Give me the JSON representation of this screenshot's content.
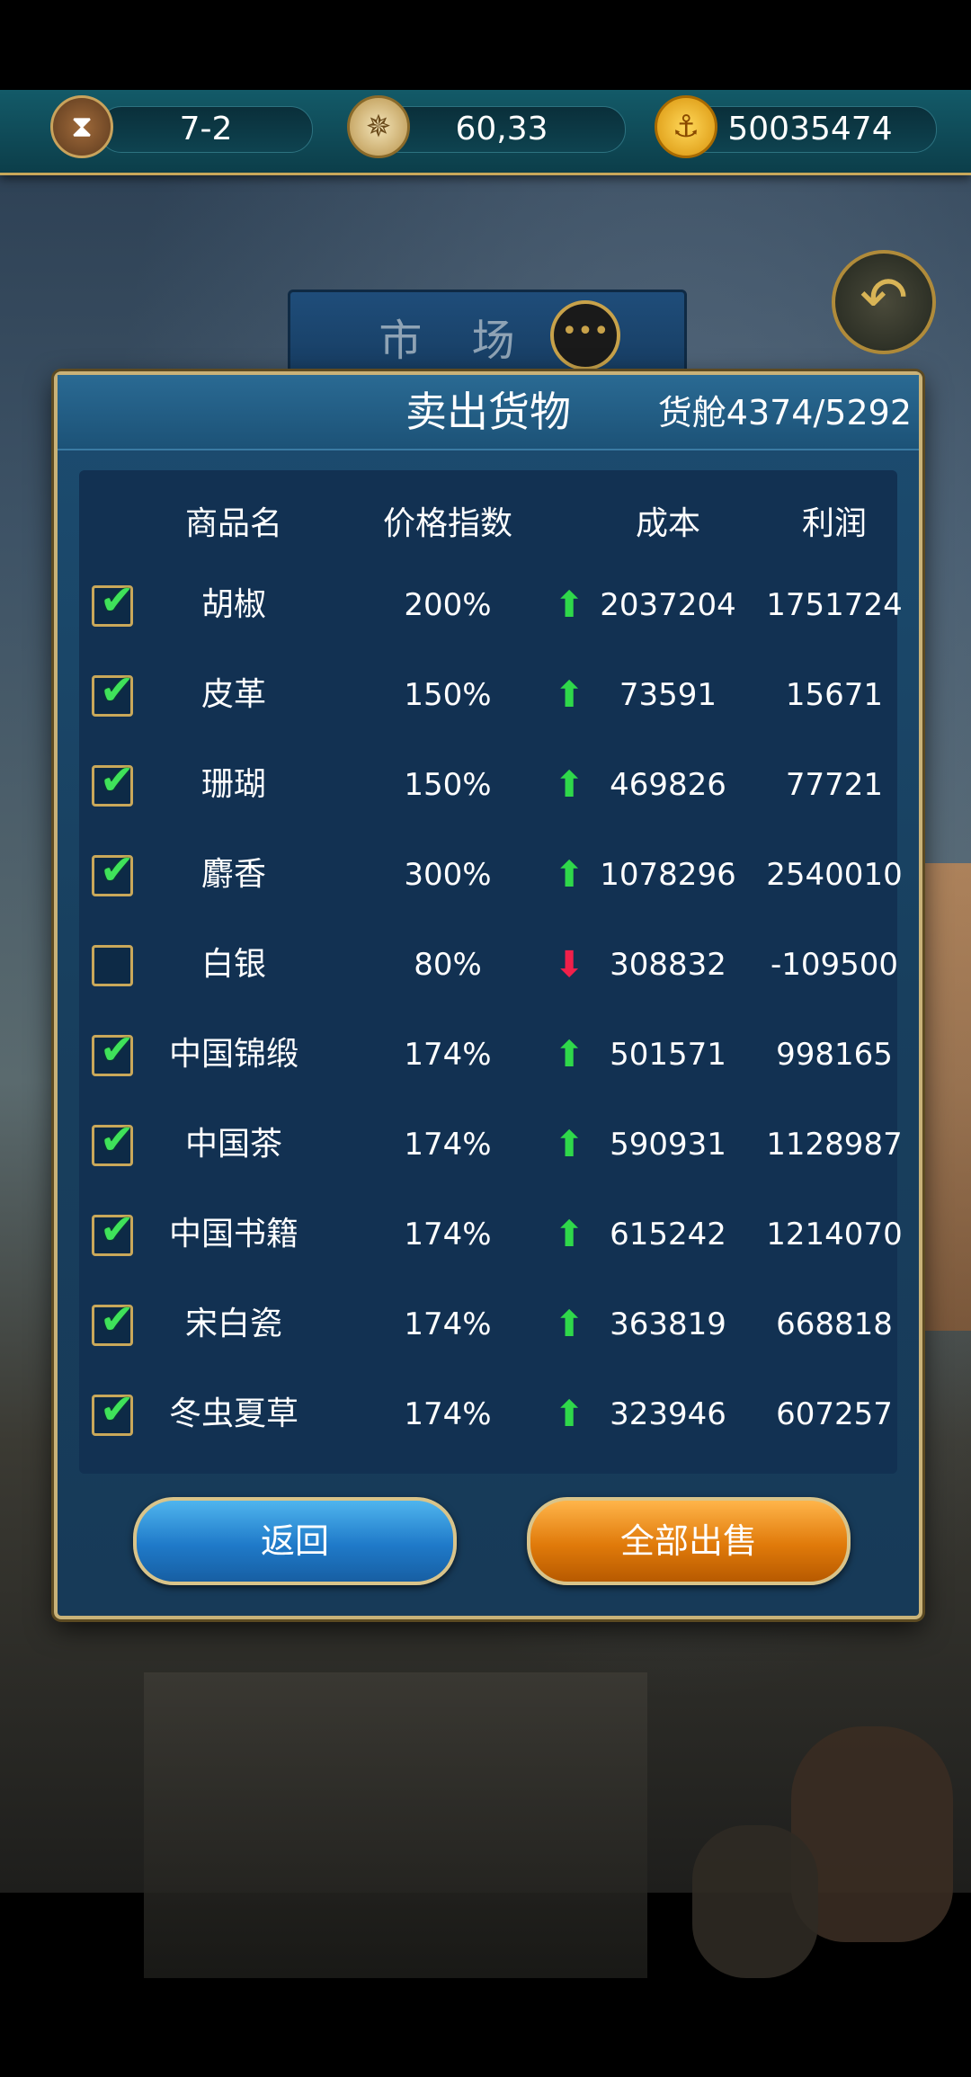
{
  "topbar": {
    "time": "7-2",
    "position": "60,33",
    "gold": "50035474"
  },
  "market": {
    "title": "市 场"
  },
  "dialog": {
    "title": "卖出货物",
    "cargo": "货舱4374/5292",
    "columns": [
      "商品名",
      "价格指数",
      "成本",
      "利润"
    ],
    "rows": [
      {
        "name": "胡椒",
        "checked": true,
        "pct": "200%",
        "trend": "up",
        "cost": "2037204",
        "profit": "1751724"
      },
      {
        "name": "皮革",
        "checked": true,
        "pct": "150%",
        "trend": "up",
        "cost": "73591",
        "profit": "15671"
      },
      {
        "name": "珊瑚",
        "checked": true,
        "pct": "150%",
        "trend": "up",
        "cost": "469826",
        "profit": "77721"
      },
      {
        "name": "麝香",
        "checked": true,
        "pct": "300%",
        "trend": "up",
        "cost": "1078296",
        "profit": "2540010"
      },
      {
        "name": "白银",
        "checked": false,
        "pct": "80%",
        "trend": "down",
        "cost": "308832",
        "profit": "-109500"
      },
      {
        "name": "中国锦缎",
        "checked": true,
        "pct": "174%",
        "trend": "up",
        "cost": "501571",
        "profit": "998165"
      },
      {
        "name": "中国茶",
        "checked": true,
        "pct": "174%",
        "trend": "up",
        "cost": "590931",
        "profit": "1128987"
      },
      {
        "name": "中国书籍",
        "checked": true,
        "pct": "174%",
        "trend": "up",
        "cost": "615242",
        "profit": "1214070"
      },
      {
        "name": "宋白瓷",
        "checked": true,
        "pct": "174%",
        "trend": "up",
        "cost": "363819",
        "profit": "668818"
      },
      {
        "name": "冬虫夏草",
        "checked": true,
        "pct": "174%",
        "trend": "up",
        "cost": "323946",
        "profit": "607257"
      }
    ],
    "buttons": {
      "back": "返回",
      "sell_all": "全部出售"
    }
  },
  "colors": {
    "up": "#2fd84a",
    "down": "#f0204a",
    "check": "#3fe25a"
  },
  "icons": {
    "time": "hourglass-icon",
    "position": "compass-icon",
    "gold": "gold-coin-icon",
    "back": "back-arrow-icon",
    "chat": "chat-bubble-icon"
  }
}
